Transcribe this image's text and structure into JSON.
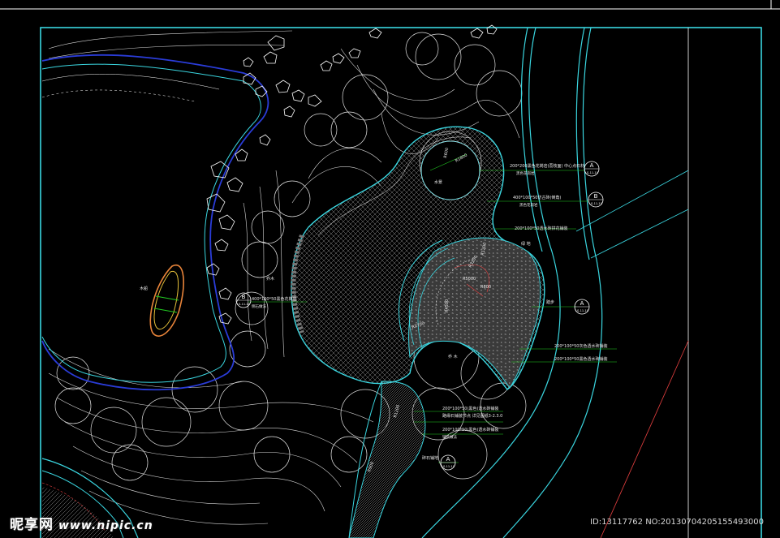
{
  "drawing": {
    "background": "#000000",
    "frame_color": "#3ad6e0",
    "annotation_color": "#e8e8e8",
    "leader_color": "#22cc22",
    "hatch_color": "#9a9a9a"
  },
  "annotations": {
    "paving_circle_top": "200*200黑色花岗岩(荔枝面) 中心点石材",
    "paving_circle_top_sub": "黑色花岗岩",
    "paving_ring": "400*100*50仿古砖(倒角)",
    "paving_ring_sub": "黑色花岗岩",
    "paving_center": "200*100*50透水砖拼花铺装",
    "paving_right_strip": "200*100*50灰色透水砖铺装",
    "paving_right_strip2": "200*100*50黑色透水砖铺装",
    "paving_bottom_1": "200*100*50(黑色)透水砖铺装",
    "paving_bottom_2": "路缘石铺装节点 详见图纸3-2.3.0",
    "paving_bottom_3": "200*100*50(黑色)透水砖铺装",
    "paving_bottom_3b": "铺装做法",
    "paving_left": "400*100*50黑色花岗岩",
    "paving_left_sub": "侧石做法",
    "label_boat": "木船",
    "label_tree": "乔木",
    "label_pool": "水景",
    "label_stair": "踏步",
    "label_plant1": "乔 木",
    "label_plant2": "绿 地",
    "label_gravel": "碎石铺地",
    "dim_circle_r": "R1800",
    "dim_r2": "R600",
    "dim_r3": "R3200",
    "dim_r4": "R1200",
    "dim_r5": "R5000",
    "dim_r6": "R4500",
    "dim_r7": "R2700",
    "dim_r8": "R600",
    "dim_r9": "R1200",
    "dim_r10": "R900"
  },
  "callouts": [
    {
      "letter": "A",
      "ref": "LS-11-10"
    },
    {
      "letter": "B",
      "ref": "LS-11-10"
    },
    {
      "letter": "A",
      "ref": "LS-11-10"
    },
    {
      "letter": "B",
      "ref": "LS-11-10"
    },
    {
      "letter": "A",
      "ref": "LS-11-10"
    }
  ],
  "watermark": {
    "site": "昵享网",
    "url": "www.nipic.cn",
    "id": "ID:13117762 NO:20130704205155493000"
  }
}
